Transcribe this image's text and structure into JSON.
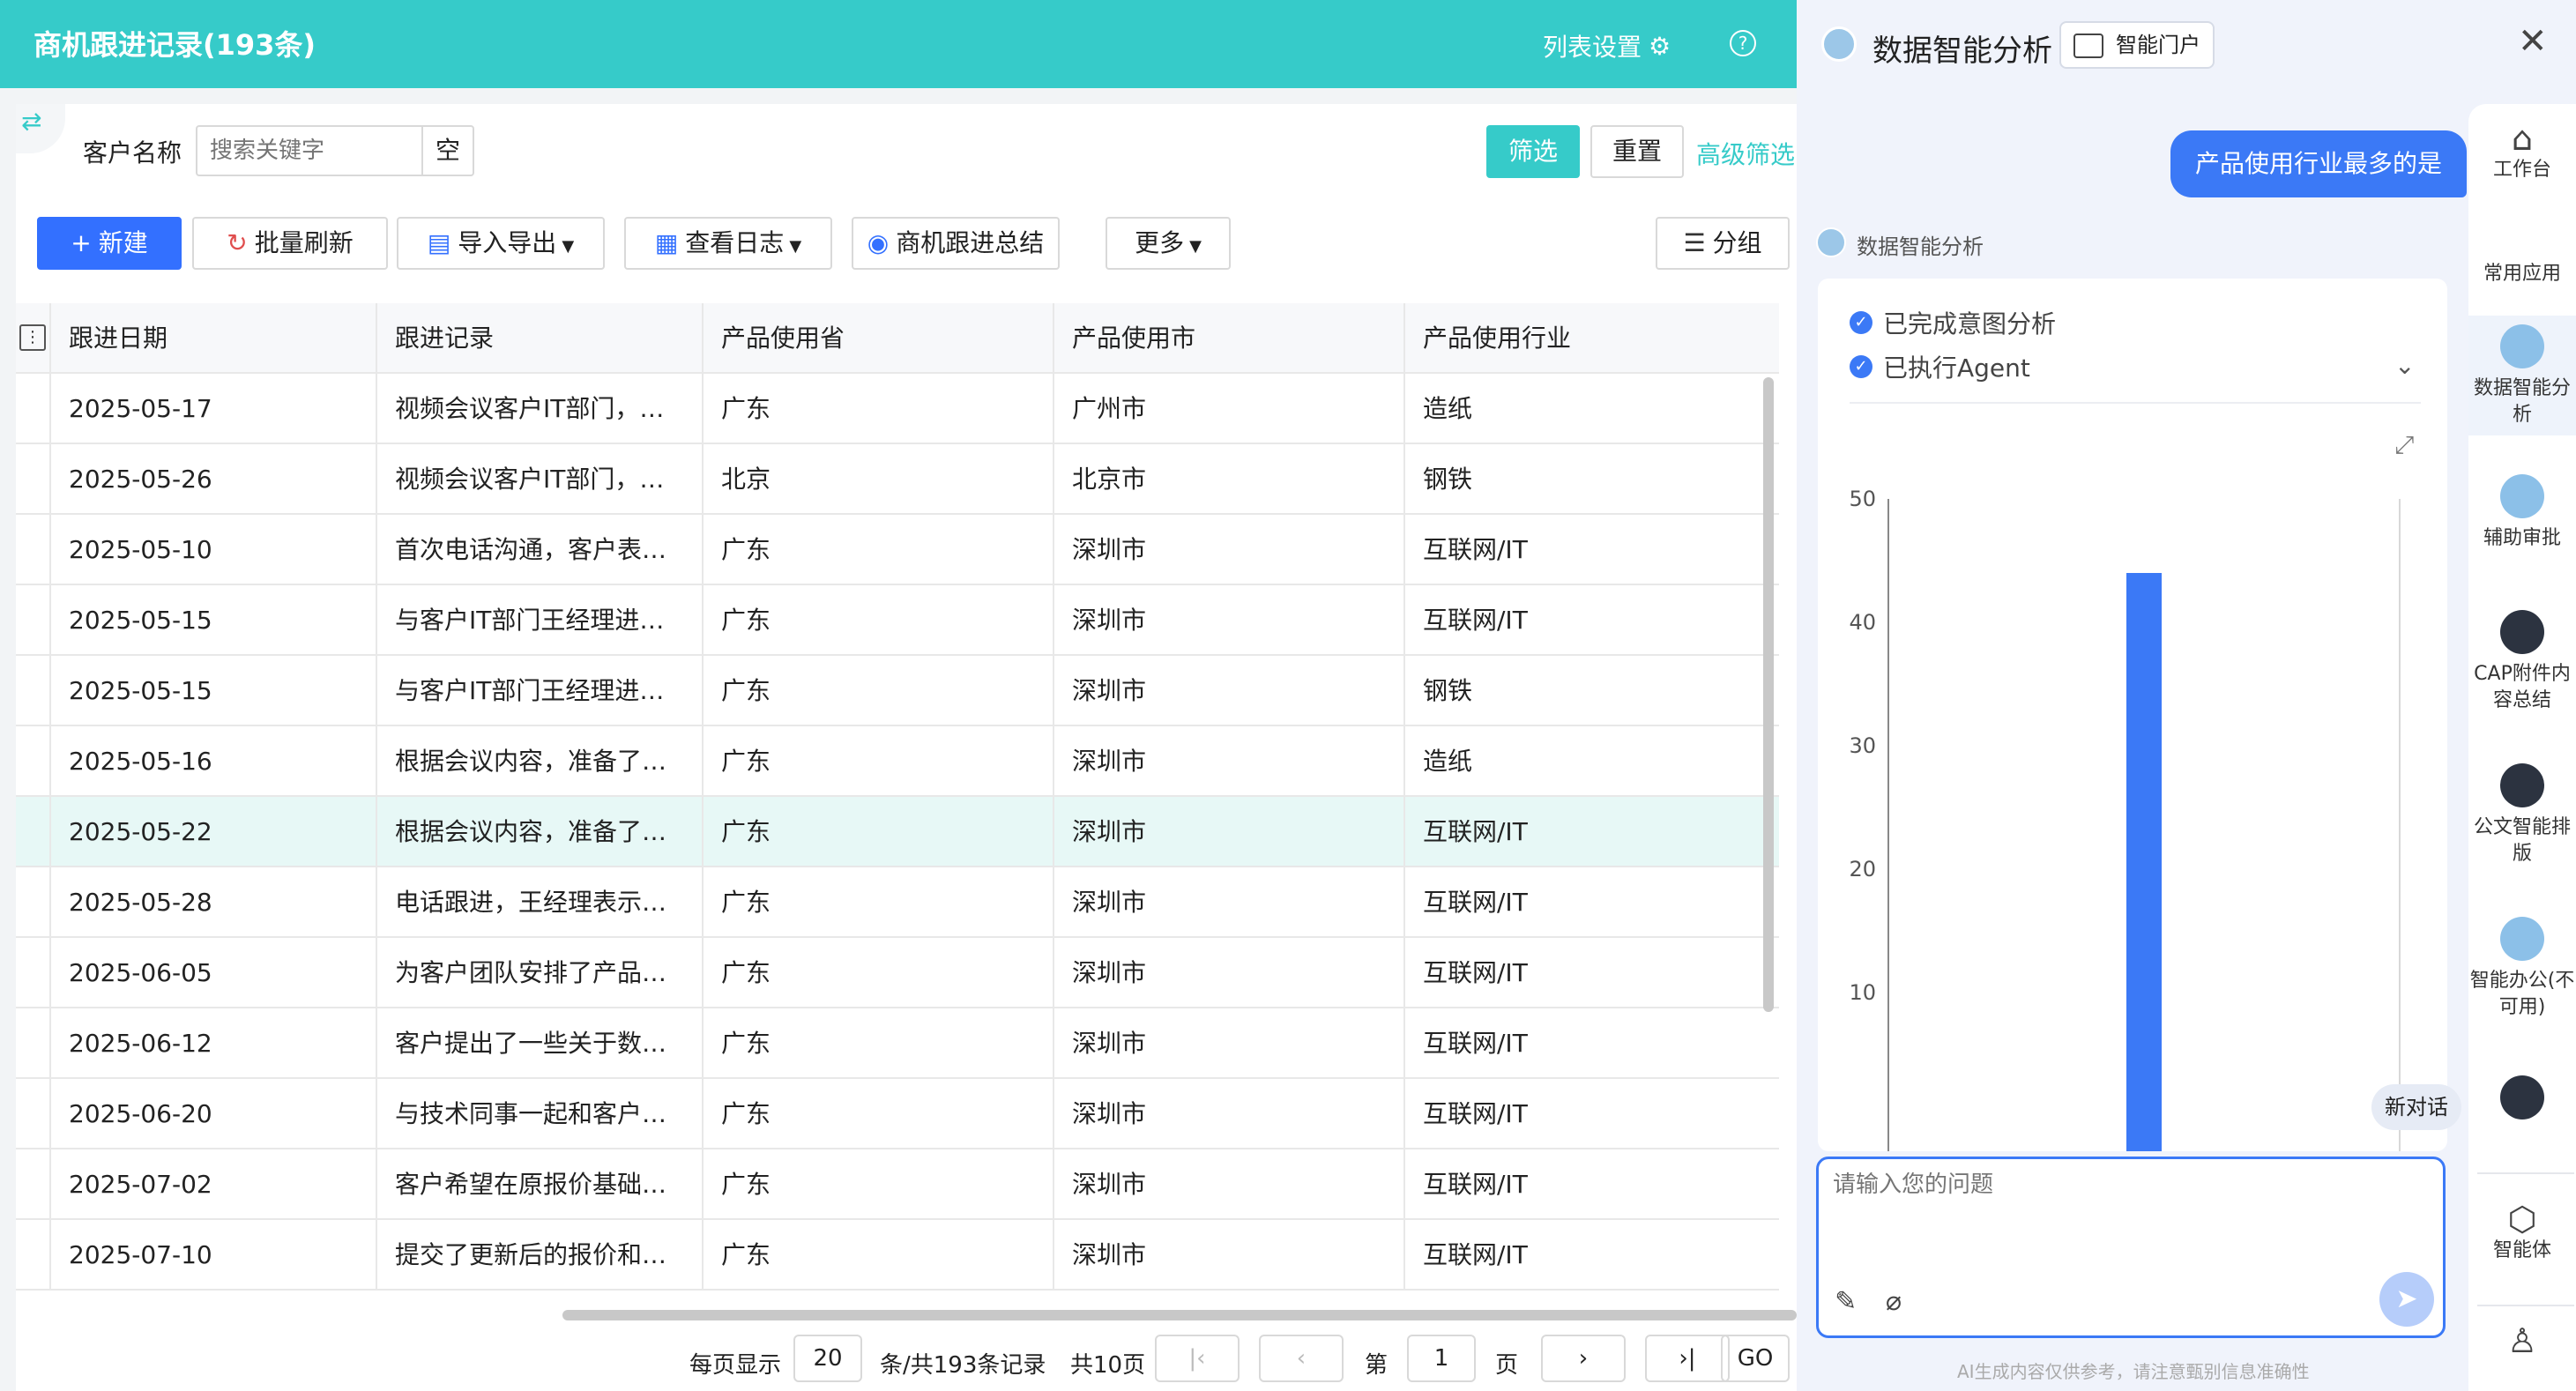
{
  "header": {
    "title": "商机跟进记录(193条)",
    "list_settings": "列表设置",
    "help_icon": "?"
  },
  "filter": {
    "label": "客户名称",
    "search_placeholder": "搜索关键字",
    "empty_label": "空",
    "filter_button": "筛选",
    "reset_button": "重置",
    "advanced": "高级筛选"
  },
  "toolbar": {
    "new": "新建",
    "batch_refresh": "批量刷新",
    "import_export": "导入导出",
    "view_log": "查看日志",
    "summary": "商机跟进总结",
    "more": "更多",
    "group": "分组"
  },
  "table": {
    "columns": [
      "跟进日期",
      "跟进记录",
      "产品使用省",
      "产品使用市",
      "产品使用行业"
    ],
    "rows": [
      [
        "2025-05-17",
        "视频会议客户IT部门，…",
        "广东",
        "广州市",
        "造纸"
      ],
      [
        "2025-05-26",
        "视频会议客户IT部门，…",
        "北京",
        "北京市",
        "钢铁"
      ],
      [
        "2025-05-10",
        "首次电话沟通，客户表…",
        "广东",
        "深圳市",
        "互联网/IT"
      ],
      [
        "2025-05-15",
        "与客户IT部门王经理进…",
        "广东",
        "深圳市",
        "互联网/IT"
      ],
      [
        "2025-05-15",
        "与客户IT部门王经理进…",
        "广东",
        "深圳市",
        "钢铁"
      ],
      [
        "2025-05-16",
        "根据会议内容，准备了…",
        "广东",
        "深圳市",
        "造纸"
      ],
      [
        "2025-05-22",
        "根据会议内容，准备了…",
        "广东",
        "深圳市",
        "互联网/IT"
      ],
      [
        "2025-05-28",
        "电话跟进，王经理表示…",
        "广东",
        "深圳市",
        "互联网/IT"
      ],
      [
        "2025-06-05",
        "为客户团队安排了产品…",
        "广东",
        "深圳市",
        "互联网/IT"
      ],
      [
        "2025-06-12",
        "客户提出了一些关于数…",
        "广东",
        "深圳市",
        "互联网/IT"
      ],
      [
        "2025-06-20",
        "与技术同事一起和客户…",
        "广东",
        "深圳市",
        "互联网/IT"
      ],
      [
        "2025-07-02",
        "客户希望在原报价基础…",
        "广东",
        "深圳市",
        "互联网/IT"
      ],
      [
        "2025-07-10",
        "提交了更新后的报价和…",
        "广东",
        "深圳市",
        "互联网/IT"
      ]
    ]
  },
  "pager": {
    "per_page_label": "每页显示",
    "per_page": "20",
    "records_label": "条/共193条记录",
    "total_pages": "共10页",
    "page_prefix": "第",
    "page": "1",
    "page_suffix": "页",
    "go": "GO"
  },
  "assistant": {
    "title": "数据智能分析",
    "portal": "智能门户",
    "user_message": "产品使用行业最多的是",
    "bot_name": "数据智能分析",
    "step1": "已完成意图分析",
    "step2": "已执行Agent",
    "new_chat": "新对话",
    "input_placeholder": "请输入您的问题",
    "disclaimer": "AI生成内容仅供参考，请注意甄别信息准确性"
  },
  "rail": {
    "workbench": "工作台",
    "common_apps": "常用应用",
    "data_analysis": "数据智能分析",
    "assist_approval": "辅助审批",
    "cap_summary": "CAP附件内容总结",
    "doc_layout": "公文智能排版",
    "smart_office": "智能办公(不可用)",
    "agent": "智能体"
  },
  "chart_data": {
    "type": "bar",
    "categories": [
      ""
    ],
    "values": [
      44
    ],
    "ylim": [
      0,
      50
    ],
    "yticks": [
      10,
      20,
      30,
      40,
      50
    ],
    "color": "#3b79f6",
    "grid": false
  }
}
